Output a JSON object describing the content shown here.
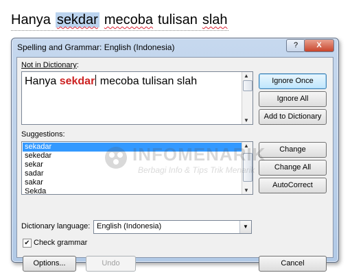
{
  "document": {
    "words": [
      "Hanya",
      "sekdar",
      "mecoba",
      "tulisan",
      "slah"
    ],
    "selected_word": "sekdar"
  },
  "dialog": {
    "title": "Spelling and Grammar: English (Indonesia)",
    "help_glyph": "?",
    "close_glyph": "X",
    "not_in_dictionary": {
      "label_pre": "Not in Dictionary",
      "label_post": ":",
      "text_before": "Hanya ",
      "flagged_word": "sekdar",
      "text_after": " mecoba  tulisan  slah"
    },
    "suggestions": {
      "label": "Suggestions:",
      "items": [
        "sekadar",
        "sekedar",
        "sekar",
        "sadar",
        "sakar",
        "Sekda"
      ],
      "selected_index": 0
    },
    "buttons": {
      "ignore_once": "Ignore Once",
      "ignore_all": "Ignore All",
      "add_to_dictionary": "Add to Dictionary",
      "change": "Change",
      "change_all": "Change All",
      "autocorrect": "AutoCorrect",
      "options": "Options...",
      "undo": "Undo",
      "cancel": "Cancel"
    },
    "dictionary_language": {
      "label": "Dictionary language:",
      "value": "English (Indonesia)"
    },
    "check_grammar": {
      "label": "Check grammar",
      "checked": true
    }
  },
  "watermark": {
    "title": "INFOMENARIK",
    "subtitle": "Berbagi Info & Tips Trik Menarik"
  },
  "colors": {
    "selection": "#3399ff",
    "flagged_word": "#cc2222",
    "window_frame": "#b1c9e6"
  }
}
